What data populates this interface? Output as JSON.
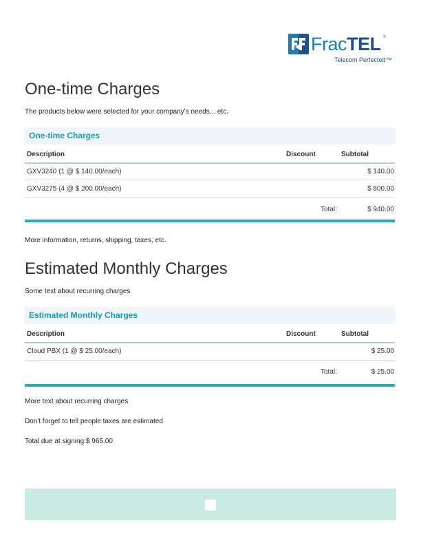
{
  "logo": {
    "name_part1": "Frac",
    "name_part2": "TEL",
    "trademark": "®",
    "tagline": "Telecom Perfected™",
    "colors": {
      "light_blue": "#1b7cb8",
      "dark_blue": "#1d4f91"
    }
  },
  "one_time": {
    "heading": "One-time Charges",
    "intro": "The products below were selected for your company's needs... etc.",
    "table": {
      "title": "One-time Charges",
      "columns": {
        "description": "Description",
        "discount": "Discount",
        "subtotal": "Subtotal"
      },
      "rows": [
        {
          "description": "GXV3240 (1 @ $ 140.00/each)",
          "discount": "",
          "subtotal": "$ 140.00"
        },
        {
          "description": "GXV3275 (4 @ $ 200.00/each)",
          "discount": "",
          "subtotal": "$ 800.00"
        }
      ],
      "total_label": "Total:",
      "total_value": "$ 940.00"
    },
    "after_text": "More information, returns, shipping, taxes, etc."
  },
  "monthly": {
    "heading": "Estimated Monthly Charges",
    "intro": "Some text about recurring charges",
    "table": {
      "title": "Estimated Monthly Charges",
      "columns": {
        "description": "Description",
        "discount": "Discount",
        "subtotal": "Subtotal"
      },
      "rows": [
        {
          "description": "Cloud PBX (1 @ $ 25.00/each)",
          "discount": "",
          "subtotal": "$ 25.00"
        }
      ],
      "total_label": "Total:",
      "total_value": "$ 25.00"
    },
    "after_text_1": "More text about recurring charges",
    "after_text_2": "Don't forget to tell people taxes are estimated",
    "total_due": "Total due at signing:$ 965.00"
  },
  "colors": {
    "accent_teal": "#1b9ab4",
    "table_header_bg": "#eef6fa",
    "bottom_bar": "#2ba9b8",
    "footer_band": "#c9ebe4"
  }
}
